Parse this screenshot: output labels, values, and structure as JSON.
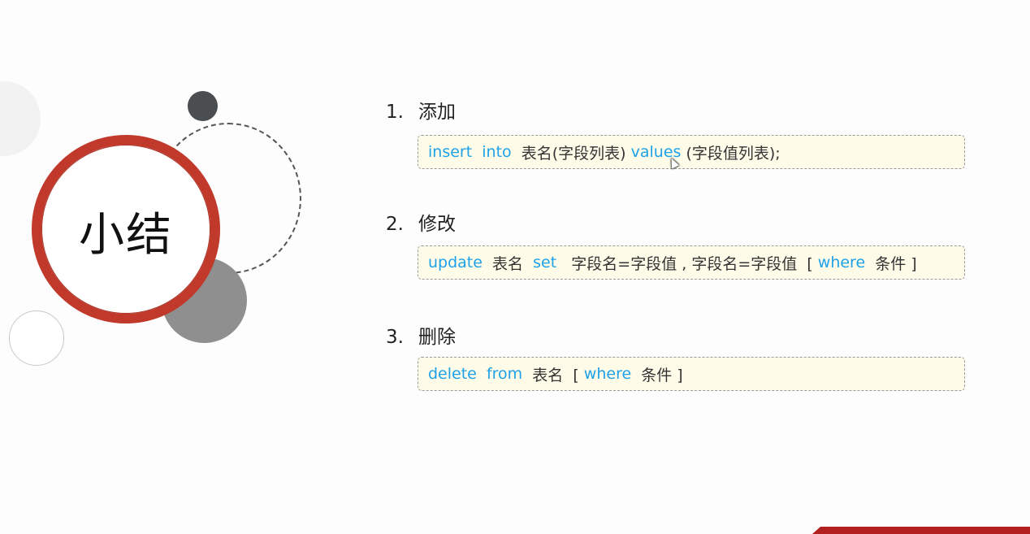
{
  "title": "小结",
  "accent_color": "#c0392b",
  "keyword_color": "#1ea1e8",
  "sections": [
    {
      "number": "1.",
      "heading": "添加",
      "code": [
        {
          "text": "insert",
          "kind": "keyword"
        },
        {
          "text": "  ",
          "kind": "text"
        },
        {
          "text": "into",
          "kind": "keyword"
        },
        {
          "text": "  表名(字段列表) ",
          "kind": "text"
        },
        {
          "text": "values",
          "kind": "keyword"
        },
        {
          "text": " (字段值列表);",
          "kind": "text"
        }
      ]
    },
    {
      "number": "2.",
      "heading": "修改",
      "code": [
        {
          "text": "update",
          "kind": "keyword"
        },
        {
          "text": "  表名  ",
          "kind": "text"
        },
        {
          "text": "set",
          "kind": "keyword"
        },
        {
          "text": "   字段名=字段值 , 字段名=字段值  [ ",
          "kind": "text"
        },
        {
          "text": "where",
          "kind": "keyword"
        },
        {
          "text": "  条件 ]",
          "kind": "text"
        }
      ]
    },
    {
      "number": "3.",
      "heading": "删除",
      "code": [
        {
          "text": "delete",
          "kind": "keyword"
        },
        {
          "text": "  ",
          "kind": "text"
        },
        {
          "text": "from",
          "kind": "keyword"
        },
        {
          "text": "  表名  [ ",
          "kind": "text"
        },
        {
          "text": "where",
          "kind": "keyword"
        },
        {
          "text": "  条件 ]",
          "kind": "text"
        }
      ]
    }
  ]
}
